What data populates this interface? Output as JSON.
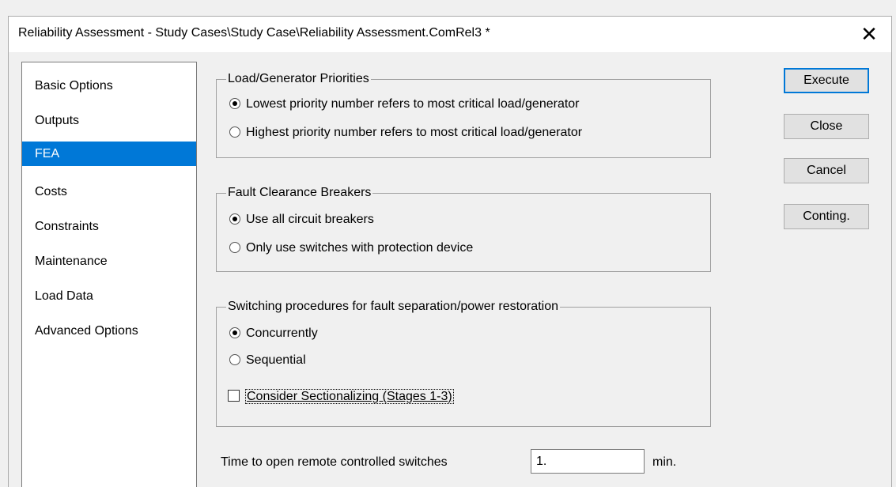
{
  "window": {
    "title": "Reliability Assessment - Study Cases\\Study Case\\Reliability Assessment.ComRel3 *",
    "close_glyph": "✕"
  },
  "nav": {
    "items": [
      {
        "label": "Basic Options"
      },
      {
        "label": "Outputs"
      },
      {
        "label": "FEA",
        "selected": true
      },
      {
        "label": "Costs"
      },
      {
        "label": "Constraints"
      },
      {
        "label": "Maintenance"
      },
      {
        "label": "Load Data"
      },
      {
        "label": "Advanced Options"
      }
    ]
  },
  "groups": {
    "priorities": {
      "title": "Load/Generator Priorities",
      "options": [
        {
          "label": "Lowest priority number refers to most critical load/generator",
          "checked": true
        },
        {
          "label": "Highest priority number refers to most critical load/generator",
          "checked": false
        }
      ]
    },
    "breakers": {
      "title": "Fault Clearance Breakers",
      "options": [
        {
          "label": "Use all circuit breakers",
          "checked": true
        },
        {
          "label": "Only use switches with protection device",
          "checked": false
        }
      ]
    },
    "switching": {
      "title": "Switching procedures for fault separation/power restoration",
      "options": [
        {
          "label": "Concurrently",
          "checked": true
        },
        {
          "label": "Sequential",
          "checked": false
        }
      ],
      "sectionalizing": {
        "label": "Consider Sectionalizing (Stages 1-3)",
        "checked": false
      }
    }
  },
  "time": {
    "label": "Time to open remote controlled switches",
    "value": "1.",
    "unit": "min."
  },
  "buttons": {
    "execute": "Execute",
    "close": "Close",
    "cancel": "Cancel",
    "conting": "Conting."
  },
  "colors": {
    "selection": "#0078d7",
    "background": "#f0f0f0"
  }
}
